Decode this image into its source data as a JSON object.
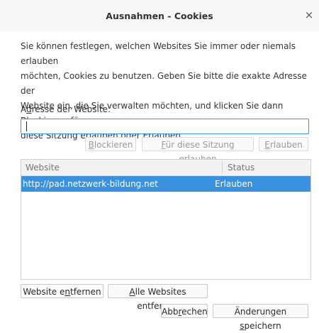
{
  "window": {
    "title": "Ausnahmen - Cookies",
    "close_glyph": "×"
  },
  "description": {
    "lines": [
      "Sie können festlegen, welchen Websites Sie immer oder niemals erlauben",
      "möchten, Cookies zu benutzen. Geben Sie bitte die exakte Adresse der",
      "Website ein, die Sie verwalten möchten, und klicken Sie dann Blockieren, für",
      "diese Sitzung erlauben oder Erlauben."
    ]
  },
  "address": {
    "label_prefix": "A",
    "label_mnemonic": "d",
    "label_rest": "resse der Website:",
    "value": "",
    "placeholder": ""
  },
  "actions": {
    "block_mnemonic": "B",
    "block_rest": "lockieren",
    "session_mnemonic": "F",
    "session_rest": "ür diese Sitzung erlauben",
    "allow_mnemonic": "E",
    "allow_rest": "rlauben"
  },
  "table": {
    "columns": [
      "Website",
      "Status"
    ],
    "rows": [
      {
        "website": "http://pad.netzwerk-bildung.net",
        "status": "Erlauben",
        "selected": true
      }
    ]
  },
  "bottom": {
    "remove_prefix": "Website e",
    "remove_mnemonic": "n",
    "remove_rest": "tfernen",
    "remove_all_mnemonic": "A",
    "remove_all_rest": "lle Websites entfernen",
    "cancel_prefix": "Abb",
    "cancel_mnemonic": "r",
    "cancel_rest": "echen",
    "save_prefix": "Änderungen ",
    "save_mnemonic": "s",
    "save_rest": "peichern"
  },
  "colors": {
    "accent": "#3a91e0",
    "input_focus": "#3d8fd8"
  }
}
